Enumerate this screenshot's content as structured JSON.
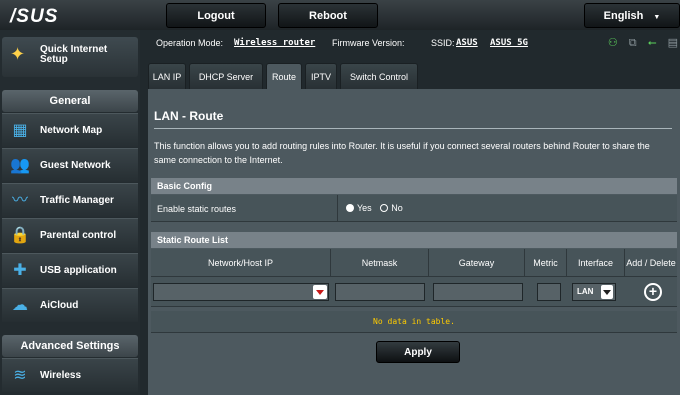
{
  "topbar": {
    "logo": "/SUS",
    "logout": "Logout",
    "reboot": "Reboot",
    "language": "English"
  },
  "sidebar": {
    "qis_label": "Quick Internet Setup",
    "general_header": "General",
    "items": [
      {
        "label": "Network Map",
        "icon": "network-map-icon"
      },
      {
        "label": "Guest Network",
        "icon": "guest-network-icon"
      },
      {
        "label": "Traffic Manager",
        "icon": "traffic-manager-icon"
      },
      {
        "label": "Parental control",
        "icon": "parental-control-icon"
      },
      {
        "label": "USB application",
        "icon": "usb-application-icon"
      },
      {
        "label": "AiCloud",
        "icon": "aicloud-icon"
      }
    ],
    "advanced_header": "Advanced Settings",
    "advanced_items": [
      {
        "label": "Wireless",
        "icon": "wireless-icon"
      }
    ]
  },
  "status": {
    "op_mode_label": "Operation Mode:",
    "op_mode_value": "Wireless router",
    "firmware_label": "Firmware Version:",
    "firmware_value": "",
    "ssid_label": "SSID:",
    "ssid_1": "ASUS",
    "ssid_2": "ASUS_5G"
  },
  "tabs": [
    "LAN IP",
    "DHCP Server",
    "Route",
    "IPTV",
    "Switch Control"
  ],
  "active_tab": "Route",
  "page": {
    "title": "LAN - Route",
    "description": "This function allows you to add routing rules into Router. It is useful if you connect several routers behind Router to share the same connection to the Internet."
  },
  "basic_config": {
    "header": "Basic Config",
    "static_routes_label": "Enable static routes",
    "yes": "Yes",
    "no": "No",
    "selected": "Yes"
  },
  "route_list": {
    "header": "Static Route List",
    "columns": [
      "Network/Host IP",
      "Netmask",
      "Gateway",
      "Metric",
      "Interface",
      "Add / Delete"
    ],
    "interface_value": "LAN",
    "empty_text": "No data in table."
  },
  "apply_label": "Apply",
  "colors": {
    "background": "#4d595f",
    "accent_yellow": "#ffcc00",
    "icon_blue": "#4ab0e6"
  }
}
